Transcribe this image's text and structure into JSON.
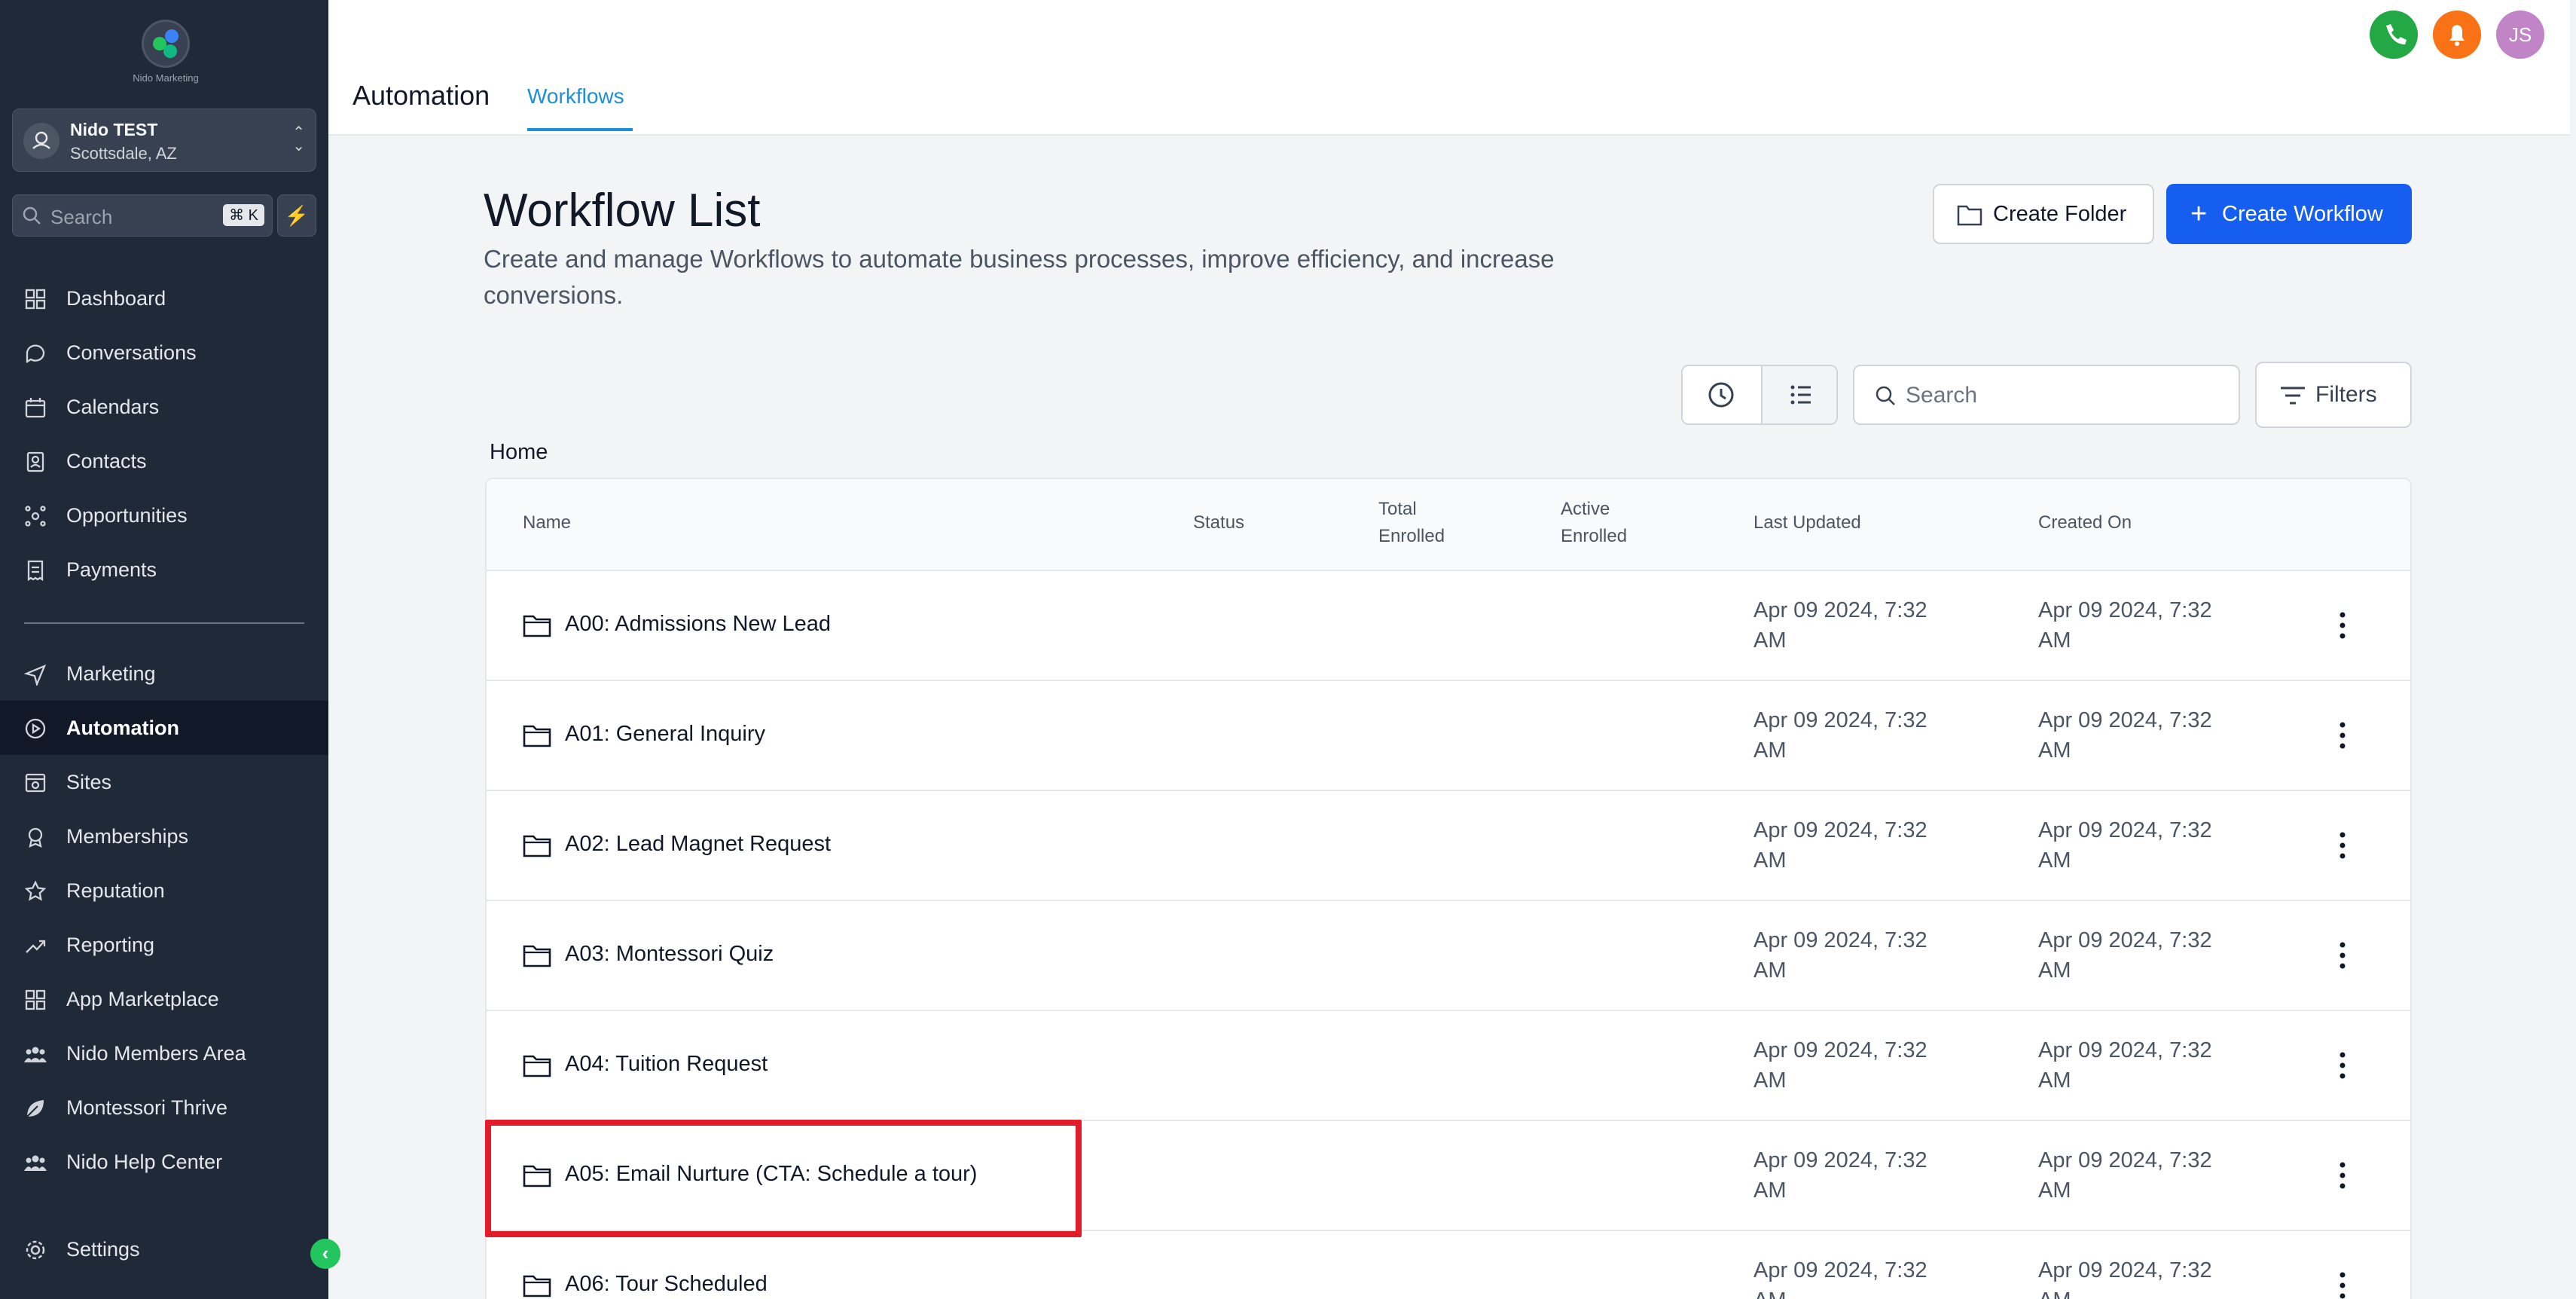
{
  "sidebar": {
    "logo_text": "Nido Marketing",
    "account": {
      "name": "Nido TEST",
      "location": "Scottsdale, AZ"
    },
    "search": {
      "placeholder": "Search",
      "shortcut": "⌘ K"
    },
    "nav_top": [
      {
        "label": "Dashboard",
        "icon": "dashboard-icon"
      },
      {
        "label": "Conversations",
        "icon": "chat-icon"
      },
      {
        "label": "Calendars",
        "icon": "calendar-icon"
      },
      {
        "label": "Contacts",
        "icon": "contacts-icon"
      },
      {
        "label": "Opportunities",
        "icon": "opportunities-icon"
      },
      {
        "label": "Payments",
        "icon": "payments-icon"
      }
    ],
    "nav_bottom": [
      {
        "label": "Marketing",
        "icon": "send-icon"
      },
      {
        "label": "Automation",
        "icon": "automation-icon",
        "active": true
      },
      {
        "label": "Sites",
        "icon": "sites-icon"
      },
      {
        "label": "Memberships",
        "icon": "membership-icon"
      },
      {
        "label": "Reputation",
        "icon": "star-icon"
      },
      {
        "label": "Reporting",
        "icon": "trend-icon"
      },
      {
        "label": "App Marketplace",
        "icon": "grid-icon"
      },
      {
        "label": "Nido Members Area",
        "icon": "users-icon"
      },
      {
        "label": "Montessori Thrive",
        "icon": "leaf-icon"
      },
      {
        "label": "Nido Help Center",
        "icon": "users-icon"
      }
    ],
    "settings_label": "Settings"
  },
  "header": {
    "title": "Automation",
    "tab": "Workflows",
    "avatar_initials": "JS",
    "colors": {
      "phone": "#22a845",
      "bell": "#f97316",
      "avatar": "#c084c7"
    }
  },
  "main": {
    "title": "Workflow List",
    "subtitle": "Create and manage Workflows to automate business processes, improve efficiency, and increase conversions.",
    "create_folder_label": "Create Folder",
    "create_workflow_label": "Create Workflow",
    "search_placeholder": "Search",
    "filters_label": "Filters",
    "breadcrumb": "Home"
  },
  "table": {
    "columns": {
      "name": "Name",
      "status": "Status",
      "total_enrolled_1": "Total",
      "total_enrolled_2": "Enrolled",
      "active_enrolled_1": "Active",
      "active_enrolled_2": "Enrolled",
      "last_updated": "Last Updated",
      "created_on": "Created On"
    },
    "rows": [
      {
        "name": "A00: Admissions New Lead",
        "updated_1": "Apr 09 2024, 7:32",
        "updated_2": "AM",
        "created_1": "Apr 09 2024, 7:32",
        "created_2": "AM"
      },
      {
        "name": "A01: General Inquiry",
        "updated_1": "Apr 09 2024, 7:32",
        "updated_2": "AM",
        "created_1": "Apr 09 2024, 7:32",
        "created_2": "AM"
      },
      {
        "name": "A02: Lead Magnet Request",
        "updated_1": "Apr 09 2024, 7:32",
        "updated_2": "AM",
        "created_1": "Apr 09 2024, 7:32",
        "created_2": "AM"
      },
      {
        "name": "A03: Montessori Quiz",
        "updated_1": "Apr 09 2024, 7:32",
        "updated_2": "AM",
        "created_1": "Apr 09 2024, 7:32",
        "created_2": "AM"
      },
      {
        "name": "A04: Tuition Request",
        "updated_1": "Apr 09 2024, 7:32",
        "updated_2": "AM",
        "created_1": "Apr 09 2024, 7:32",
        "created_2": "AM"
      },
      {
        "name": "A05: Email Nurture (CTA: Schedule a tour)",
        "updated_1": "Apr 09 2024, 7:32",
        "updated_2": "AM",
        "created_1": "Apr 09 2024, 7:32",
        "created_2": "AM"
      },
      {
        "name": "A06: Tour Scheduled",
        "updated_1": "Apr 09 2024, 7:32",
        "updated_2": "AM",
        "created_1": "Apr 09 2024, 7:32",
        "created_2": "AM"
      }
    ]
  }
}
